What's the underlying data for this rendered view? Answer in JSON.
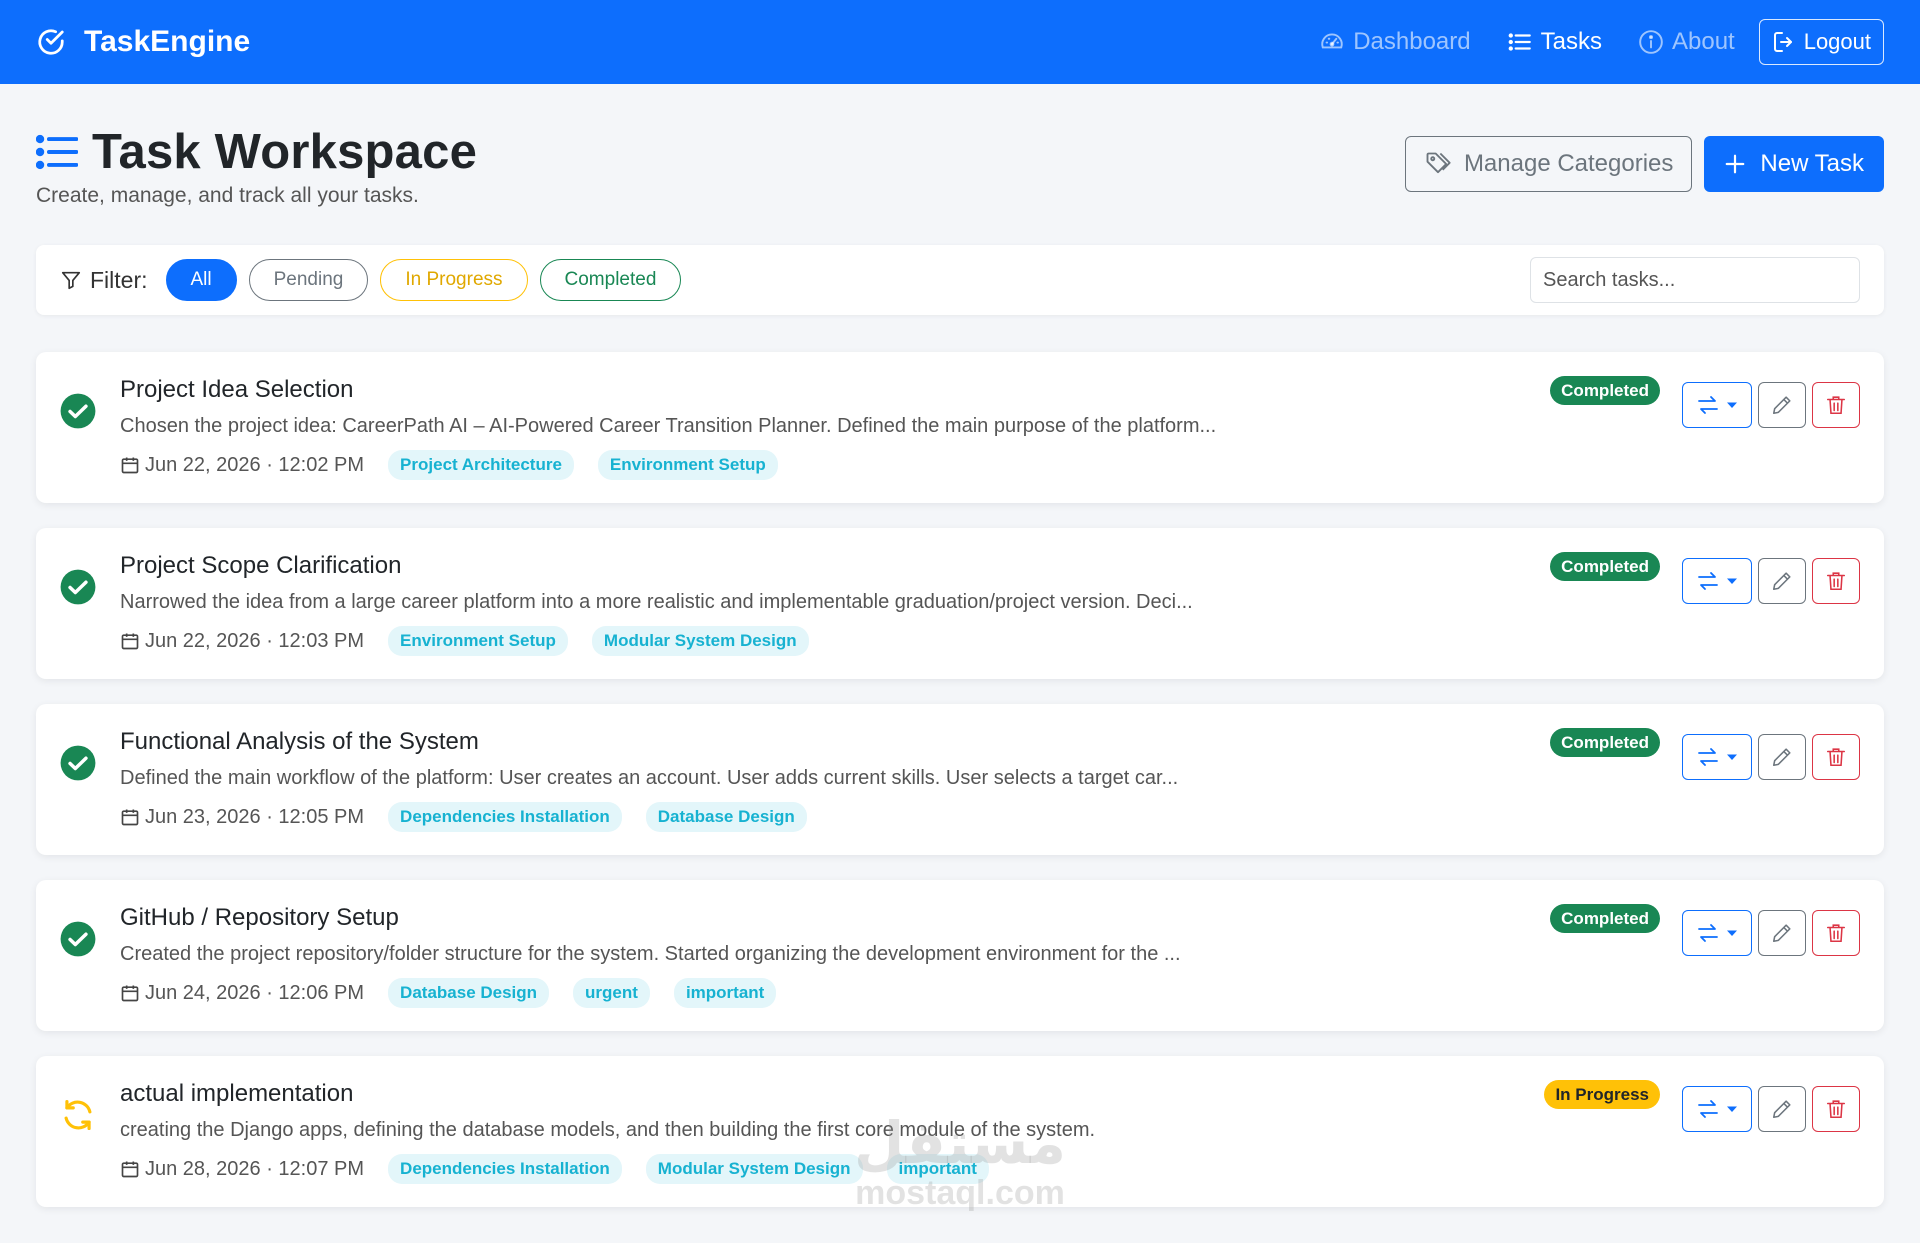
{
  "nav": {
    "brand": "TaskEngine",
    "links": [
      {
        "label": "Dashboard",
        "icon": "speedometer-icon",
        "active": false
      },
      {
        "label": "Tasks",
        "icon": "list-icon",
        "active": true
      },
      {
        "label": "About",
        "icon": "info-circle-icon",
        "active": false
      }
    ],
    "logout_label": "Logout"
  },
  "header": {
    "title": "Task Workspace",
    "subtitle": "Create, manage, and track all your tasks.",
    "manage_categories_label": "Manage Categories",
    "new_task_label": "New Task"
  },
  "filter": {
    "label": "Filter:",
    "options": [
      "All",
      "Pending",
      "In Progress",
      "Completed"
    ],
    "selected": "All",
    "search_placeholder": "Search tasks..."
  },
  "tasks": [
    {
      "title": "Project Idea Selection",
      "description": "Chosen the project idea: CareerPath AI – AI-Powered Career Transition Planner. Defined the main purpose of the platform...",
      "date": "Jun 22, 2026 · 12:02 PM",
      "tags": [
        "Project Architecture",
        "Environment Setup"
      ],
      "status": "Completed"
    },
    {
      "title": "Project Scope Clarification",
      "description": "Narrowed the idea from a large career platform into a more realistic and implementable graduation/project version. Deci...",
      "date": "Jun 22, 2026 · 12:03 PM",
      "tags": [
        "Environment Setup",
        "Modular System Design"
      ],
      "status": "Completed"
    },
    {
      "title": "Functional Analysis of the System",
      "description": "Defined the main workflow of the platform: User creates an account. User adds current skills. User selects a target car...",
      "date": "Jun 23, 2026 · 12:05 PM",
      "tags": [
        "Dependencies Installation",
        "Database Design"
      ],
      "status": "Completed"
    },
    {
      "title": "GitHub / Repository Setup",
      "description": "Created the project repository/folder structure for the system. Started organizing the development environment for the ...",
      "date": "Jun 24, 2026 · 12:06 PM",
      "tags": [
        "Database Design",
        "urgent",
        "important"
      ],
      "status": "Completed"
    },
    {
      "title": "actual implementation",
      "description": "creating the Django apps, defining the database models, and then building the first core module of the system.",
      "date": "Jun 28, 2026 · 12:07 PM",
      "tags": [
        "Dependencies Installation",
        "Modular System Design",
        "important"
      ],
      "status": "In Progress"
    }
  ],
  "watermark": {
    "arabic": "مستقل",
    "latin": "mostaql.com"
  },
  "colors": {
    "primary": "#0d6efd",
    "success": "#198754",
    "warning": "#ffc107",
    "danger": "#dc3545",
    "tag_text": "#17b2d1",
    "tag_bg": "#e3f6fa"
  }
}
